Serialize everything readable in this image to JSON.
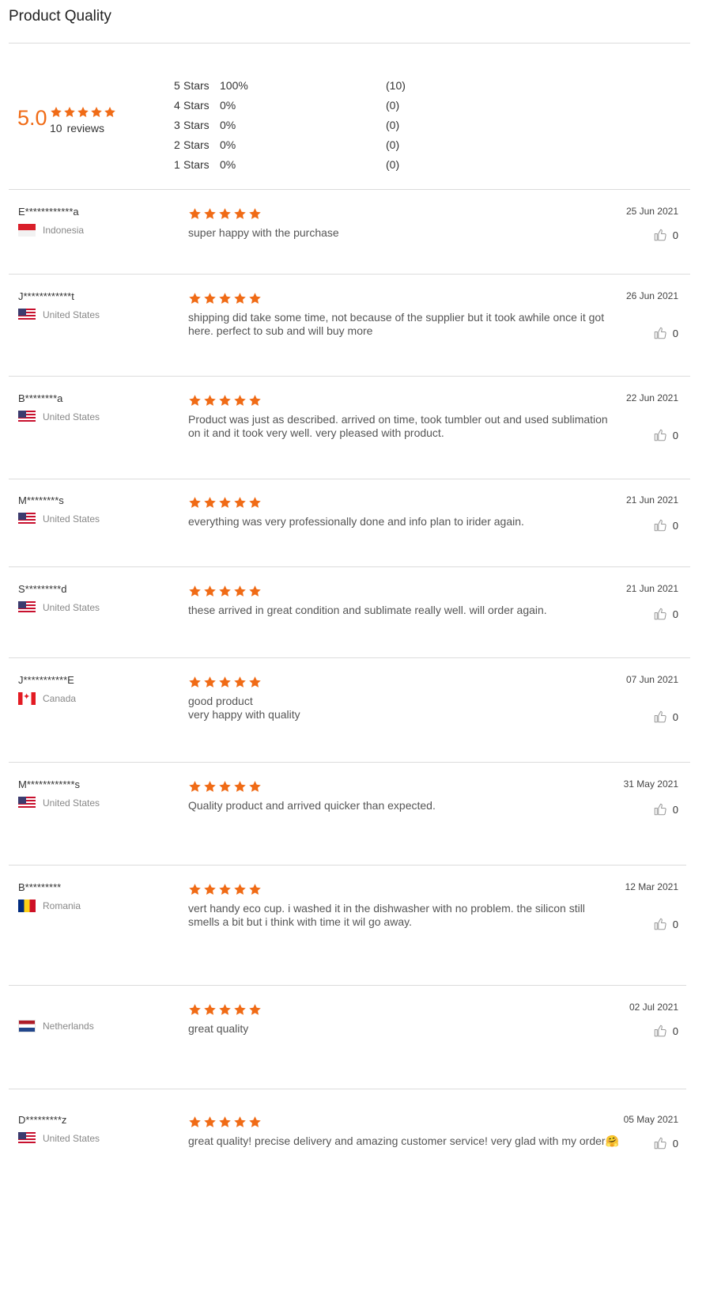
{
  "title": "Product Quality",
  "summary": {
    "average": "5.0",
    "review_count": "10",
    "reviews_label": "reviews",
    "rating_stars": 5,
    "distribution": [
      {
        "level": "5",
        "label": "Stars",
        "percent": "100%",
        "count": "(10)"
      },
      {
        "level": "4",
        "label": "Stars",
        "percent": "0%",
        "count": "(0)"
      },
      {
        "level": "3",
        "label": "Stars",
        "percent": "0%",
        "count": "(0)"
      },
      {
        "level": "2",
        "label": "Stars",
        "percent": "0%",
        "count": "(0)"
      },
      {
        "level": "1",
        "label": "Stars",
        "percent": "0%",
        "count": "(0)"
      }
    ]
  },
  "colors": {
    "star": "#f06b16",
    "accent": "#f06b16"
  },
  "reviews": [
    {
      "name": "E************a",
      "country": "Indonesia",
      "flag": "indonesia-flag",
      "stars": 5,
      "text": "super happy with the purchase",
      "date": "25 Jun 2021",
      "likes": "0"
    },
    {
      "name": "J************t",
      "country": "United States",
      "flag": "united-states-flag",
      "stars": 5,
      "text": "shipping did take some time, not because of the supplier but it took awhile once it got here. perfect to sub and will buy more",
      "date": "26 Jun 2021",
      "likes": "0"
    },
    {
      "name": "B********a",
      "country": "United States",
      "flag": "united-states-flag",
      "stars": 5,
      "text": "Product was just as described.  arrived on time, took tumbler out and used sublimation on it and it took very well.  very pleased with product.",
      "date": "22 Jun 2021",
      "likes": "0"
    },
    {
      "name": "M********s",
      "country": "United States",
      "flag": "united-states-flag",
      "stars": 5,
      "text": "everything was very professionally done and info plan to irider again.",
      "date": "21 Jun 2021",
      "likes": "0"
    },
    {
      "name": "S*********d",
      "country": "United States",
      "flag": "united-states-flag",
      "stars": 5,
      "text": "these arrived in great condition and sublimate really well.  will order again.",
      "date": "21 Jun 2021",
      "likes": "0"
    },
    {
      "name": "J***********E",
      "country": "Canada",
      "flag": "canada-flag",
      "stars": 5,
      "text": "good product\nvery happy with quality",
      "date": "07 Jun 2021",
      "likes": "0"
    },
    {
      "name": "M************s",
      "country": "United States",
      "flag": "united-states-flag",
      "stars": 5,
      "text": "Quality product and arrived quicker than expected.",
      "date": "31 May 2021",
      "likes": "0"
    },
    {
      "name": "B*********",
      "country": "Romania",
      "flag": "romania-flag",
      "stars": 5,
      "text": "vert handy eco cup. i washed it in the dishwasher with no problem. the silicon still smells a bit but i think with time it wil go away.",
      "date": "12 Mar 2021",
      "likes": "0"
    },
    {
      "name": "",
      "country": "Netherlands",
      "flag": "netherlands-flag",
      "stars": 5,
      "text": "great quality",
      "date": "02 Jul 2021",
      "likes": "0"
    },
    {
      "name": "D*********z",
      "country": "United States",
      "flag": "united-states-flag",
      "stars": 5,
      "text": "great quality! precise delivery and amazing customer service! very glad with my order🤗",
      "date": "05 May 2021",
      "likes": "0"
    }
  ]
}
